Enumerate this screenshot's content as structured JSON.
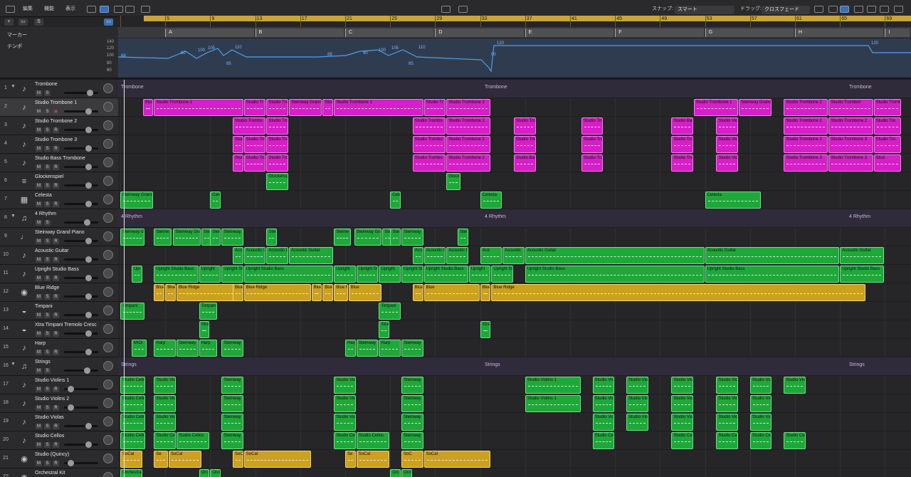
{
  "toolbar": {
    "menu_edit": "編集",
    "menu_function": "機能",
    "menu_view": "表示",
    "snap_label": "スナップ:",
    "snap_value": "スマート",
    "drag_label": "ドラッグ:",
    "drag_value": "クロスフェード"
  },
  "ruler": {
    "bars": [
      "1",
      "5",
      "9",
      "13",
      "17",
      "21",
      "25",
      "29",
      "33",
      "37",
      "41",
      "45",
      "49",
      "53",
      "57",
      "61",
      "65",
      "69"
    ]
  },
  "global_tracks": {
    "marker_label": "マーカー",
    "tempo_label": "テンポ",
    "tempo_scale": [
      "140",
      "120",
      "100",
      "80",
      "60"
    ],
    "markers": [
      "A",
      "B",
      "C",
      "D",
      "E",
      "F",
      "G",
      "H",
      "I"
    ],
    "tempo_points": [
      "88",
      "90",
      "100",
      "105",
      "110",
      "85",
      "88",
      "90",
      "100",
      "105",
      "110",
      "85",
      "90",
      "120",
      "120"
    ]
  },
  "tracks": [
    {
      "num": "1",
      "name": "Trombone",
      "folder": true,
      "icon": "♪"
    },
    {
      "num": "2",
      "name": "Studio Trombone 1",
      "folder": false,
      "icon": "♪",
      "selected": true
    },
    {
      "num": "3",
      "name": "Studio Trombone 2",
      "folder": false,
      "icon": "♪"
    },
    {
      "num": "4",
      "name": "Studio Trombone 3",
      "folder": false,
      "icon": "♪"
    },
    {
      "num": "5",
      "name": "Studio Bass Trombone",
      "folder": false,
      "icon": "♪"
    },
    {
      "num": "6",
      "name": "Glockenspiel",
      "folder": false,
      "icon": "≡"
    },
    {
      "num": "7",
      "name": "Celesta",
      "folder": false,
      "icon": "▦"
    },
    {
      "num": "8",
      "name": "4 Rhythm",
      "folder": true,
      "icon": "♫"
    },
    {
      "num": "9",
      "name": "Steinway Grand Piano",
      "folder": false,
      "icon": "♩"
    },
    {
      "num": "10",
      "name": "Acoustic Guitar",
      "folder": false,
      "icon": "♪"
    },
    {
      "num": "11",
      "name": "Upright Studio Bass",
      "folder": false,
      "icon": "♪"
    },
    {
      "num": "12",
      "name": "Blue Ridge",
      "folder": false,
      "icon": "◉"
    },
    {
      "num": "13",
      "name": "Timpani",
      "folder": false,
      "icon": "◒"
    },
    {
      "num": "14",
      "name": "Xtra Timpani Tremolo Cresc",
      "folder": false,
      "icon": "◒"
    },
    {
      "num": "15",
      "name": "Harp",
      "folder": false,
      "icon": "♪"
    },
    {
      "num": "16",
      "name": "Strings",
      "folder": true,
      "icon": "♫"
    },
    {
      "num": "17",
      "name": "Studio Violins 1",
      "folder": false,
      "icon": "♪"
    },
    {
      "num": "18",
      "name": "Studio Violins 2",
      "folder": false,
      "icon": "♪"
    },
    {
      "num": "19",
      "name": "Studio Violas",
      "folder": false,
      "icon": "♪"
    },
    {
      "num": "20",
      "name": "Studio Cellos",
      "folder": false,
      "icon": "♪"
    },
    {
      "num": "21",
      "name": "Studio (Quincy)",
      "folder": false,
      "icon": "◉"
    },
    {
      "num": "22",
      "name": "Orchestral Kit",
      "folder": false,
      "icon": "◉"
    }
  ],
  "folder_labels": {
    "trombone": "Trombone",
    "rhythm": "4 Rhythm",
    "strings": "Strings"
  },
  "regions": [
    {
      "lane": 1,
      "label": "Stud",
      "color": "mag"
    },
    {
      "lane": 1,
      "label": "Studio Trombone 1",
      "color": "mag"
    },
    {
      "lane": 1,
      "label": "Studio Tr",
      "color": "mag"
    },
    {
      "lane": 1,
      "label": "Studio Tro",
      "color": "mag"
    },
    {
      "lane": 1,
      "label": "Steinway Grand",
      "color": "mag"
    },
    {
      "lane": 1,
      "label": "Stud",
      "color": "mag"
    },
    {
      "lane": 1,
      "label": "Studio Trombone 1",
      "color": "mag"
    },
    {
      "lane": 1,
      "label": "Studio Tr",
      "color": "mag"
    },
    {
      "lane": 1,
      "label": "Studio Trombone 2",
      "color": "mag"
    },
    {
      "lane": 1,
      "label": "Studio Trombone 1",
      "color": "mag"
    },
    {
      "lane": 1,
      "label": "Steinway Grand Pi",
      "color": "mag"
    },
    {
      "lane": 1,
      "label": "Studio Trombone 2",
      "color": "mag"
    },
    {
      "lane": 1,
      "label": "Studio Trombon",
      "color": "mag"
    },
    {
      "lane": 1,
      "label": "Studio Trombone",
      "color": "mag"
    },
    {
      "lane": 2,
      "label": "Studio Trombo",
      "color": "mag"
    },
    {
      "lane": 2,
      "label": "Studio Trom",
      "color": "mag"
    },
    {
      "lane": 2,
      "label": "Studio Trombo",
      "color": "mag"
    },
    {
      "lane": 2,
      "label": "Studio Trombone 2",
      "color": "mag"
    },
    {
      "lane": 2,
      "label": "Studio Tro",
      "color": "mag"
    },
    {
      "lane": 2,
      "label": "Studio Tro",
      "color": "mag"
    },
    {
      "lane": 2,
      "label": "Studio Bass",
      "color": "mag"
    },
    {
      "lane": 2,
      "label": "Studio Viol",
      "color": "mag"
    },
    {
      "lane": 2,
      "label": "Studio Trombone 2",
      "color": "mag"
    },
    {
      "lane": 2,
      "label": "Studio Trombone 2",
      "color": "mag"
    },
    {
      "lane": 2,
      "label": "Studio Tro",
      "color": "mag"
    },
    {
      "lane": 3,
      "label": "Stud",
      "color": "mag"
    },
    {
      "lane": 3,
      "label": "Studio Trombo",
      "color": "mag"
    },
    {
      "lane": 3,
      "label": "Studio Trom",
      "color": "mag"
    },
    {
      "lane": 3,
      "label": "Studio Trombo",
      "color": "mag"
    },
    {
      "lane": 3,
      "label": "Studio Trombone 2",
      "color": "mag"
    },
    {
      "lane": 3,
      "label": "Studio Tro",
      "color": "mag"
    },
    {
      "lane": 3,
      "label": "Studio Tro",
      "color": "mag"
    },
    {
      "lane": 3,
      "label": "Studio Tro",
      "color": "mag"
    },
    {
      "lane": 3,
      "label": "Studio Viol",
      "color": "mag"
    },
    {
      "lane": 3,
      "label": "Studio Trombone 2",
      "color": "mag"
    },
    {
      "lane": 3,
      "label": "Studio Trombone 3",
      "color": "mag"
    },
    {
      "lane": 3,
      "label": "Studio Tro",
      "color": "mag"
    },
    {
      "lane": 4,
      "label": "Stud",
      "color": "mag"
    },
    {
      "lane": 4,
      "label": "Studio Trombo",
      "color": "mag"
    },
    {
      "lane": 4,
      "label": "Studio Trom",
      "color": "mag"
    },
    {
      "lane": 4,
      "label": "Studio Trombo",
      "color": "mag"
    },
    {
      "lane": 4,
      "label": "Studio Trombone 2",
      "color": "mag"
    },
    {
      "lane": 4,
      "label": "Studio Bass",
      "color": "mag"
    },
    {
      "lane": 4,
      "label": "Studio Tro",
      "color": "mag"
    },
    {
      "lane": 4,
      "label": "Studio Tro",
      "color": "mag"
    },
    {
      "lane": 4,
      "label": "Studio Viol",
      "color": "mag"
    },
    {
      "lane": 4,
      "label": "Studio Trombone 2",
      "color": "mag"
    },
    {
      "lane": 4,
      "label": "Studio Trombone 3",
      "color": "mag"
    },
    {
      "lane": 4,
      "label": "Stud",
      "color": "mag"
    },
    {
      "lane": 5,
      "label": "Glockensp",
      "color": "grn"
    },
    {
      "lane": 5,
      "label": "Glock",
      "color": "grn"
    },
    {
      "lane": 6,
      "label": "Steinway Grand",
      "color": "grn"
    },
    {
      "lane": 6,
      "label": "Cele",
      "color": "grn"
    },
    {
      "lane": 6,
      "label": "Cele",
      "color": "grn"
    },
    {
      "lane": 6,
      "label": "Celesta",
      "color": "grn"
    },
    {
      "lane": 6,
      "label": "Celesta",
      "color": "grn"
    },
    {
      "lane": 8,
      "label": "Steinway Gr",
      "color": "grn"
    },
    {
      "lane": 8,
      "label": "Steinw",
      "color": "grn"
    },
    {
      "lane": 8,
      "label": "Steinway Gra",
      "color": "grn"
    },
    {
      "lane": 8,
      "label": "Stei",
      "color": "grn"
    },
    {
      "lane": 8,
      "label": "Stei",
      "color": "grn"
    },
    {
      "lane": 8,
      "label": "Steinway",
      "color": "grn"
    },
    {
      "lane": 8,
      "label": "Stei",
      "color": "grn"
    },
    {
      "lane": 8,
      "label": "Steinw",
      "color": "grn"
    },
    {
      "lane": 8,
      "label": "Steinway Gra",
      "color": "grn"
    },
    {
      "lane": 8,
      "label": "Stei",
      "color": "grn"
    },
    {
      "lane": 8,
      "label": "Stei",
      "color": "grn"
    },
    {
      "lane": 8,
      "label": "Steinway",
      "color": "grn"
    },
    {
      "lane": 8,
      "label": "Stei",
      "color": "grn"
    },
    {
      "lane": 9,
      "label": "Aco",
      "color": "grn"
    },
    {
      "lane": 9,
      "label": "Acoustic G",
      "color": "grn"
    },
    {
      "lane": 9,
      "label": "Acoustic G",
      "color": "grn"
    },
    {
      "lane": 9,
      "label": "Acoustic Guitar",
      "color": "grn"
    },
    {
      "lane": 9,
      "label": "Aco",
      "color": "grn"
    },
    {
      "lane": 9,
      "label": "Acoustic G",
      "color": "grn"
    },
    {
      "lane": 9,
      "label": "Acoustic G",
      "color": "grn"
    },
    {
      "lane": 9,
      "label": "Ace",
      "color": "grn"
    },
    {
      "lane": 9,
      "label": "Acoustic",
      "color": "grn"
    },
    {
      "lane": 9,
      "label": "Acoustic Guitar",
      "color": "grn"
    },
    {
      "lane": 9,
      "label": "Acoustic Guitar",
      "color": "grn"
    },
    {
      "lane": 9,
      "label": "Acoustic Guitar",
      "color": "grn"
    },
    {
      "lane": 10,
      "label": "Upr",
      "color": "grn"
    },
    {
      "lane": 10,
      "label": "Upright Studio Bass",
      "color": "grn"
    },
    {
      "lane": 10,
      "label": "Upright",
      "color": "grn"
    },
    {
      "lane": 10,
      "label": "Upright St",
      "color": "grn"
    },
    {
      "lane": 10,
      "label": "Upright Studio Bass",
      "color": "grn"
    },
    {
      "lane": 10,
      "label": "Upright",
      "color": "grn"
    },
    {
      "lane": 10,
      "label": "Upright St",
      "color": "grn"
    },
    {
      "lane": 10,
      "label": "Upright",
      "color": "grn"
    },
    {
      "lane": 10,
      "label": "Upright St",
      "color": "grn"
    },
    {
      "lane": 10,
      "label": "Upright Studio Bass",
      "color": "grn"
    },
    {
      "lane": 10,
      "label": "Upright",
      "color": "grn"
    },
    {
      "lane": 10,
      "label": "Upright St",
      "color": "grn"
    },
    {
      "lane": 10,
      "label": "Upright Studio Bass",
      "color": "grn"
    },
    {
      "lane": 10,
      "label": "Upright Studio Bass",
      "color": "grn"
    },
    {
      "lane": 10,
      "label": "Upright Studio Bass",
      "color": "grn"
    },
    {
      "lane": 11,
      "label": "Blue",
      "color": "yel"
    },
    {
      "lane": 11,
      "label": "Blue",
      "color": "yel"
    },
    {
      "lane": 11,
      "label": "Blue Ridge",
      "color": "yel"
    },
    {
      "lane": 11,
      "label": "Blue",
      "color": "yel"
    },
    {
      "lane": 11,
      "label": "Blue Ridge",
      "color": "yel"
    },
    {
      "lane": 11,
      "label": "Blue",
      "color": "yel"
    },
    {
      "lane": 11,
      "label": "Blue",
      "color": "yel"
    },
    {
      "lane": 11,
      "label": "Blue Ridge",
      "color": "yel"
    },
    {
      "lane": 11,
      "label": "Blue",
      "color": "yel"
    },
    {
      "lane": 11,
      "label": "Blue Ridge",
      "color": "yel"
    },
    {
      "lane": 11,
      "label": "Blue",
      "color": "yel"
    },
    {
      "lane": 11,
      "label": "Blue Ridge",
      "color": "yel"
    },
    {
      "lane": 11,
      "label": "Blue Ridge",
      "color": "yel"
    },
    {
      "lane": 12,
      "label": "Timpani",
      "color": "grn"
    },
    {
      "lane": 12,
      "label": "Timpani",
      "color": "grn"
    },
    {
      "lane": 12,
      "label": "Timpani",
      "color": "grn"
    },
    {
      "lane": 13,
      "label": "Xtra",
      "color": "grn"
    },
    {
      "lane": 13,
      "label": "Xtra",
      "color": "grn"
    },
    {
      "lane": 13,
      "label": "Xtra",
      "color": "grn"
    },
    {
      "lane": 14,
      "label": "MIDI",
      "color": "grn"
    },
    {
      "lane": 14,
      "label": "Harp",
      "color": "grn"
    },
    {
      "lane": 14,
      "label": "Steinway",
      "color": "grn"
    },
    {
      "lane": 14,
      "label": "Harp",
      "color": "grn"
    },
    {
      "lane": 14,
      "label": "Steinway",
      "color": "grn"
    },
    {
      "lane": 14,
      "label": "Harp",
      "color": "grn"
    },
    {
      "lane": 14,
      "label": "Steinway",
      "color": "grn"
    },
    {
      "lane": 14,
      "label": "Harp",
      "color": "grn"
    },
    {
      "lane": 14,
      "label": "Steinway",
      "color": "grn"
    },
    {
      "lane": 16,
      "label": "Studio Cellos",
      "color": "grn"
    },
    {
      "lane": 16,
      "label": "Studio Viol",
      "color": "grn"
    },
    {
      "lane": 16,
      "label": "Steinway",
      "color": "grn"
    },
    {
      "lane": 16,
      "label": "Studio Viol",
      "color": "grn"
    },
    {
      "lane": 16,
      "label": "Steinway",
      "color": "grn"
    },
    {
      "lane": 16,
      "label": "Studio Violins 1",
      "color": "grn"
    },
    {
      "lane": 16,
      "label": "Studio Viol",
      "color": "grn"
    },
    {
      "lane": 16,
      "label": "Studio Viol",
      "color": "grn"
    },
    {
      "lane": 16,
      "label": "Studio Viol",
      "color": "grn"
    },
    {
      "lane": 16,
      "label": "Studio Viol",
      "color": "grn"
    },
    {
      "lane": 16,
      "label": "Studio Viol",
      "color": "grn"
    },
    {
      "lane": 16,
      "label": "Studio Viol",
      "color": "grn"
    },
    {
      "lane": 17,
      "label": "Studio Cellos",
      "color": "grn"
    },
    {
      "lane": 17,
      "label": "Studio Viol",
      "color": "grn"
    },
    {
      "lane": 17,
      "label": "Steinway",
      "color": "grn"
    },
    {
      "lane": 17,
      "label": "Studio Viol",
      "color": "grn"
    },
    {
      "lane": 17,
      "label": "Steinway",
      "color": "grn"
    },
    {
      "lane": 17,
      "label": "Studio Violins 1",
      "color": "grn"
    },
    {
      "lane": 17,
      "label": "Studio Viol",
      "color": "grn"
    },
    {
      "lane": 17,
      "label": "Studio Viol",
      "color": "grn"
    },
    {
      "lane": 17,
      "label": "Studio Viol",
      "color": "grn"
    },
    {
      "lane": 17,
      "label": "Studio Viol",
      "color": "grn"
    },
    {
      "lane": 17,
      "label": "Studio Viol",
      "color": "grn"
    },
    {
      "lane": 18,
      "label": "Studio Cellos",
      "color": "grn"
    },
    {
      "lane": 18,
      "label": "Studio Viol",
      "color": "grn"
    },
    {
      "lane": 18,
      "label": "Steinway",
      "color": "grn"
    },
    {
      "lane": 18,
      "label": "Studio Viol",
      "color": "grn"
    },
    {
      "lane": 18,
      "label": "Steinway",
      "color": "grn"
    },
    {
      "lane": 18,
      "label": "Studio Viol",
      "color": "grn"
    },
    {
      "lane": 18,
      "label": "Studio Viol",
      "color": "grn"
    },
    {
      "lane": 18,
      "label": "Studio Viol",
      "color": "grn"
    },
    {
      "lane": 18,
      "label": "Studio Viol",
      "color": "grn"
    },
    {
      "lane": 18,
      "label": "Studio Viol",
      "color": "grn"
    },
    {
      "lane": 19,
      "label": "Studio Cellos",
      "color": "grn"
    },
    {
      "lane": 19,
      "label": "Studio Cell",
      "color": "grn"
    },
    {
      "lane": 19,
      "label": "Studio Cellos",
      "color": "grn"
    },
    {
      "lane": 19,
      "label": "Steinway",
      "color": "grn"
    },
    {
      "lane": 19,
      "label": "Studio Cell",
      "color": "grn"
    },
    {
      "lane": 19,
      "label": "Studio Cellos",
      "color": "grn"
    },
    {
      "lane": 19,
      "label": "Steinway",
      "color": "grn"
    },
    {
      "lane": 19,
      "label": "Studio Cell",
      "color": "grn"
    },
    {
      "lane": 19,
      "label": "Studio Cell",
      "color": "grn"
    },
    {
      "lane": 19,
      "label": "Studio Cell",
      "color": "grn"
    },
    {
      "lane": 19,
      "label": "Studio Cell",
      "color": "grn"
    },
    {
      "lane": 19,
      "label": "Studio Cell",
      "color": "grn"
    },
    {
      "lane": 20,
      "label": "SoCal",
      "color": "yel"
    },
    {
      "lane": 20,
      "label": "Se",
      "color": "yel"
    },
    {
      "lane": 20,
      "label": "SoCal",
      "color": "yel"
    },
    {
      "lane": 20,
      "label": "SoC",
      "color": "yel"
    },
    {
      "lane": 20,
      "label": "SoCal",
      "color": "yel"
    },
    {
      "lane": 20,
      "label": "Se",
      "color": "yel"
    },
    {
      "lane": 20,
      "label": "SoCal",
      "color": "yel"
    },
    {
      "lane": 20,
      "label": "SoC",
      "color": "yel"
    },
    {
      "lane": 20,
      "label": "SoCal",
      "color": "yel"
    },
    {
      "lane": 21,
      "label": "Orchestral",
      "color": "grn"
    },
    {
      "lane": 21,
      "label": "Orc",
      "color": "grn"
    },
    {
      "lane": 21,
      "label": "Orch",
      "color": "grn"
    },
    {
      "lane": 21,
      "label": "Orc",
      "color": "grn"
    },
    {
      "lane": 21,
      "label": "Orch",
      "color": "grn"
    }
  ],
  "colors": {
    "magenta": "#d61fc8",
    "green": "#1fa83a",
    "yellow": "#cca120",
    "ruler": "#c9a538"
  }
}
